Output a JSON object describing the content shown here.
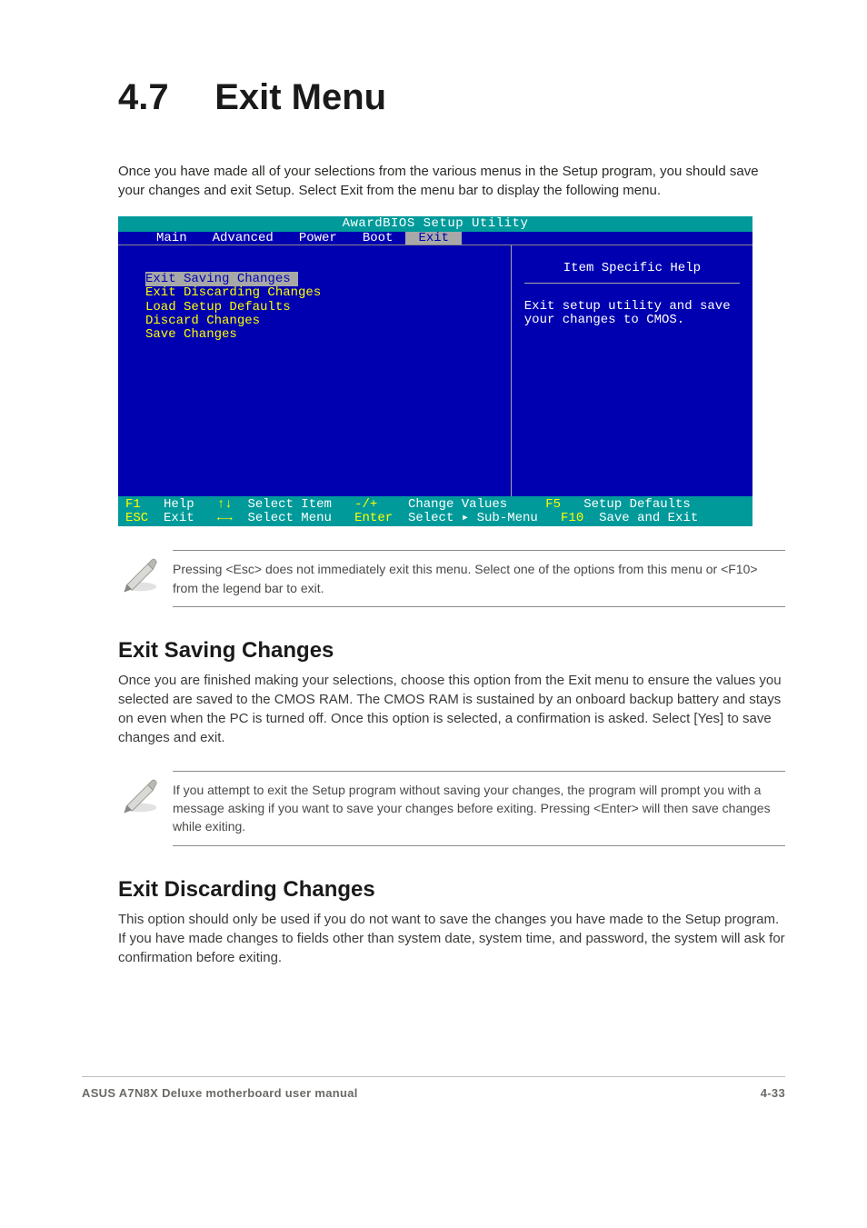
{
  "heading": {
    "number": "4.7",
    "title": "Exit Menu"
  },
  "intro_para": "Once you have made all of your selections from the various menus in the Setup program, you should save your changes and exit Setup. Select Exit from the menu bar to display the following menu.",
  "bios": {
    "title": "AwardBIOS Setup Utility",
    "tabs": [
      "Main",
      "Advanced",
      "Power",
      "Boot",
      "Exit"
    ],
    "active_tab": "Exit",
    "menu_items": [
      "Exit Saving Changes",
      "Exit Discarding Changes",
      "Load Setup Defaults",
      "Discard Changes",
      "Save Changes"
    ],
    "help_title": "Item Specific Help",
    "help_body": "Exit setup utility and save your changes to CMOS.",
    "footer": {
      "r1_k1": "F1",
      "r1_l1": "Help",
      "r1_k2": "↑↓",
      "r1_l2": "Select Item",
      "r1_k3": "-/+",
      "r1_l3": "Change Values",
      "r1_k4": "F5",
      "r1_l4": "Setup Defaults",
      "r2_k1": "ESC",
      "r2_l1": "Exit",
      "r2_k2": "←→",
      "r2_l2": "Select Menu",
      "r2_k3": "Enter",
      "r2_l3": "Select ▸ Sub-Menu",
      "r2_k4": "F10",
      "r2_l4": "Save and Exit"
    }
  },
  "note1": "Pressing <Esc> does not immediately exit this menu. Select one of the options from this menu or <F10> from the legend bar to exit.",
  "sub1": {
    "title": "Exit Saving Changes",
    "body": "Once you are finished making your selections, choose this option from the Exit menu to ensure the values you selected are saved to the CMOS RAM. The CMOS RAM is sustained by an onboard backup battery and stays on even when the PC is turned off. Once this option is selected, a confirmation is asked. Select [Yes] to save changes and exit."
  },
  "note2": "If you attempt to exit the Setup program without saving your changes, the program will prompt you with a message asking if you want to save your changes before exiting. Pressing <Enter> will then save changes while exiting.",
  "sub2": {
    "title": "Exit Discarding Changes",
    "body": "This option should only be used if you do not want to save the changes you have made to the Setup program. If you have made changes to fields other than system date, system time, and password, the system will ask for confirmation before exiting."
  },
  "footer": {
    "left": "ASUS A7N8X Deluxe motherboard user manual",
    "right": "4-33"
  },
  "icon_alt": "pen-note-icon"
}
